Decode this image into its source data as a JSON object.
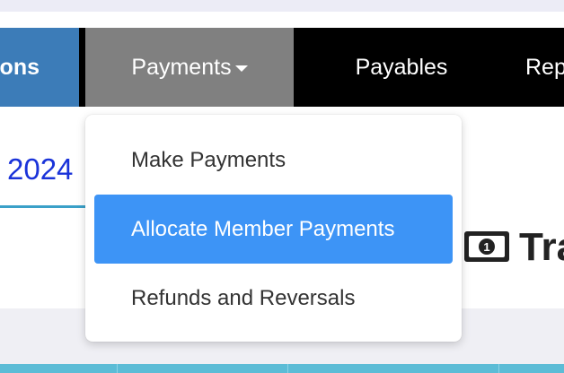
{
  "navbar": {
    "prev_item_label": "ons",
    "payments_label": "Payments",
    "payables_label": "Payables",
    "reports_label": "Rep"
  },
  "page": {
    "year_text": "2024",
    "heading_partial": "Tra"
  },
  "payments_menu": {
    "items": [
      {
        "label": "Make Payments",
        "active": false
      },
      {
        "label": "Allocate Member Payments",
        "active": true
      },
      {
        "label": "Refunds and Reversals",
        "active": false
      }
    ]
  },
  "icons": {
    "bill": "money-bill-icon",
    "caret": "caret-down-icon"
  },
  "colors": {
    "nav_background": "#000000",
    "nav_prev_active": "#3c7cb8",
    "nav_payments_open": "#808080",
    "menu_highlight": "#3d94f6",
    "year_link": "#1a33d9",
    "table_header": "#5cbcd6"
  }
}
